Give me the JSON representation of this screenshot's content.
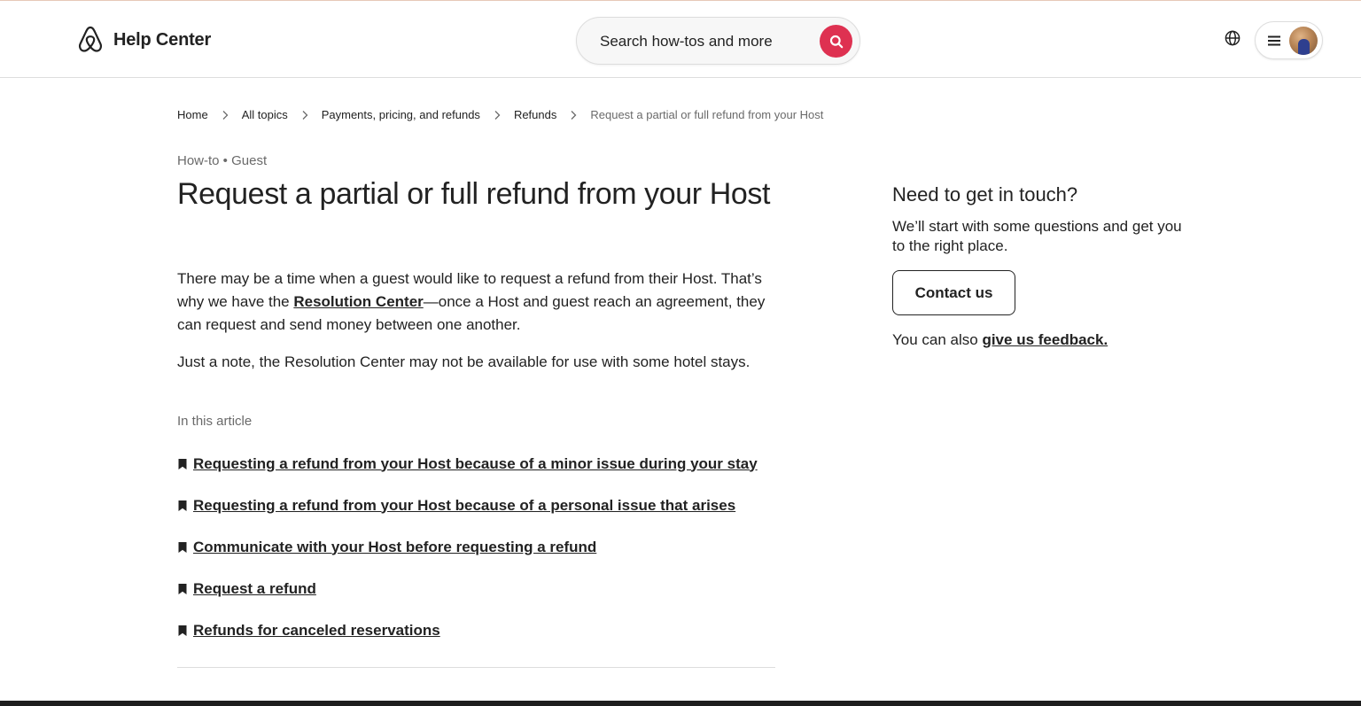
{
  "header": {
    "logo_text": "Help Center",
    "search_placeholder": "Search how-tos and more",
    "brand_color": "#de3151"
  },
  "breadcrumb": [
    {
      "label": "Home"
    },
    {
      "label": "All topics"
    },
    {
      "label": "Payments, pricing, and refunds"
    },
    {
      "label": "Refunds"
    },
    {
      "label": "Request a partial or full refund from your Host"
    }
  ],
  "article": {
    "meta": "How-to • Guest",
    "title": "Request a partial or full refund from your Host",
    "p1_before": "There may be a time when a guest would like to request a refund from their Host. That’s why we have the ",
    "p1_link": "Resolution Center",
    "p1_after": "—once a Host and guest reach an agreement, they can request and send money between one another.",
    "p2": "Just a note, the Resolution Center may not be available for use with some hotel stays.",
    "in_this_article": "In this article",
    "toc": [
      "Requesting a refund from your Host because of a minor issue during your stay",
      "Requesting a refund from your Host because of a personal issue that arises",
      "Communicate with your Host before requesting a refund",
      "Request a refund",
      "Refunds for canceled reservations"
    ]
  },
  "sidebar": {
    "title": "Need to get in touch?",
    "text": "We’ll start with some questions and get you to the right place.",
    "contact_button": "Contact us",
    "feedback_before": "You can also ",
    "feedback_link": "give us feedback."
  },
  "icons": {
    "logo": "airbnb-logo-icon",
    "search": "search-icon",
    "globe": "globe-icon",
    "menu": "hamburger-menu-icon",
    "crumb_separator": "chevron-right-icon",
    "toc_marker": "bookmark-icon"
  }
}
